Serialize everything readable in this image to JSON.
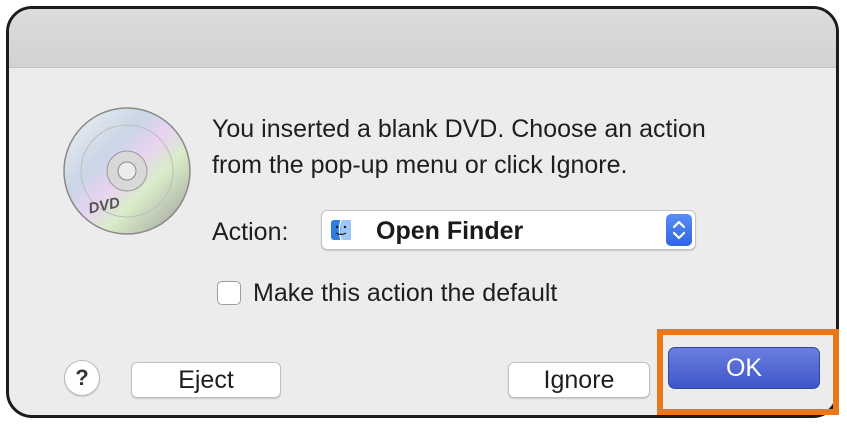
{
  "dialog": {
    "message_line1": "You inserted a blank DVD. Choose an action",
    "message_line2": "from the pop-up menu or click Ignore.",
    "disc_icon_text": "DVD",
    "action_label": "Action:",
    "action_value": "Open Finder",
    "action_icon": "finder-icon",
    "checkbox_label": "Make this action the default",
    "checkbox_checked": false
  },
  "buttons": {
    "help_label": "?",
    "eject_label": "Eject",
    "ignore_label": "Ignore",
    "ok_label": "OK"
  },
  "colors": {
    "highlight": "#e8781a",
    "ok_button": "#4a62d4",
    "stepper": "#3b6ff0"
  }
}
